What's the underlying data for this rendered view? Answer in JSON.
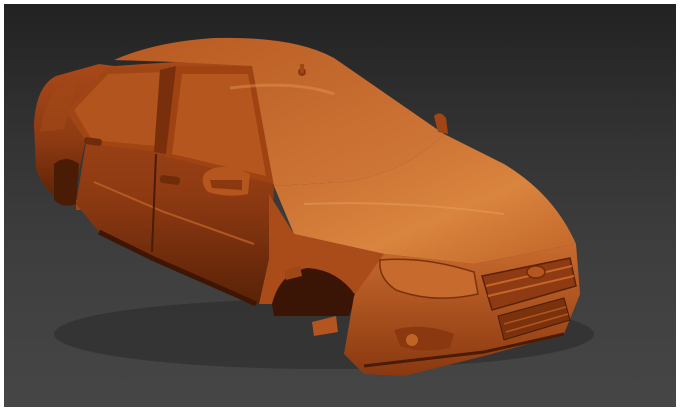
{
  "scene": {
    "subject_icon": "car-body-3d-render",
    "colors": {
      "background_top": "#222222",
      "background_bottom": "#464646",
      "clay_base": "#b5521a",
      "clay_highlight": "#d9803f",
      "clay_shadow": "#6e2c0b",
      "clay_dark": "#4a1b05"
    }
  }
}
